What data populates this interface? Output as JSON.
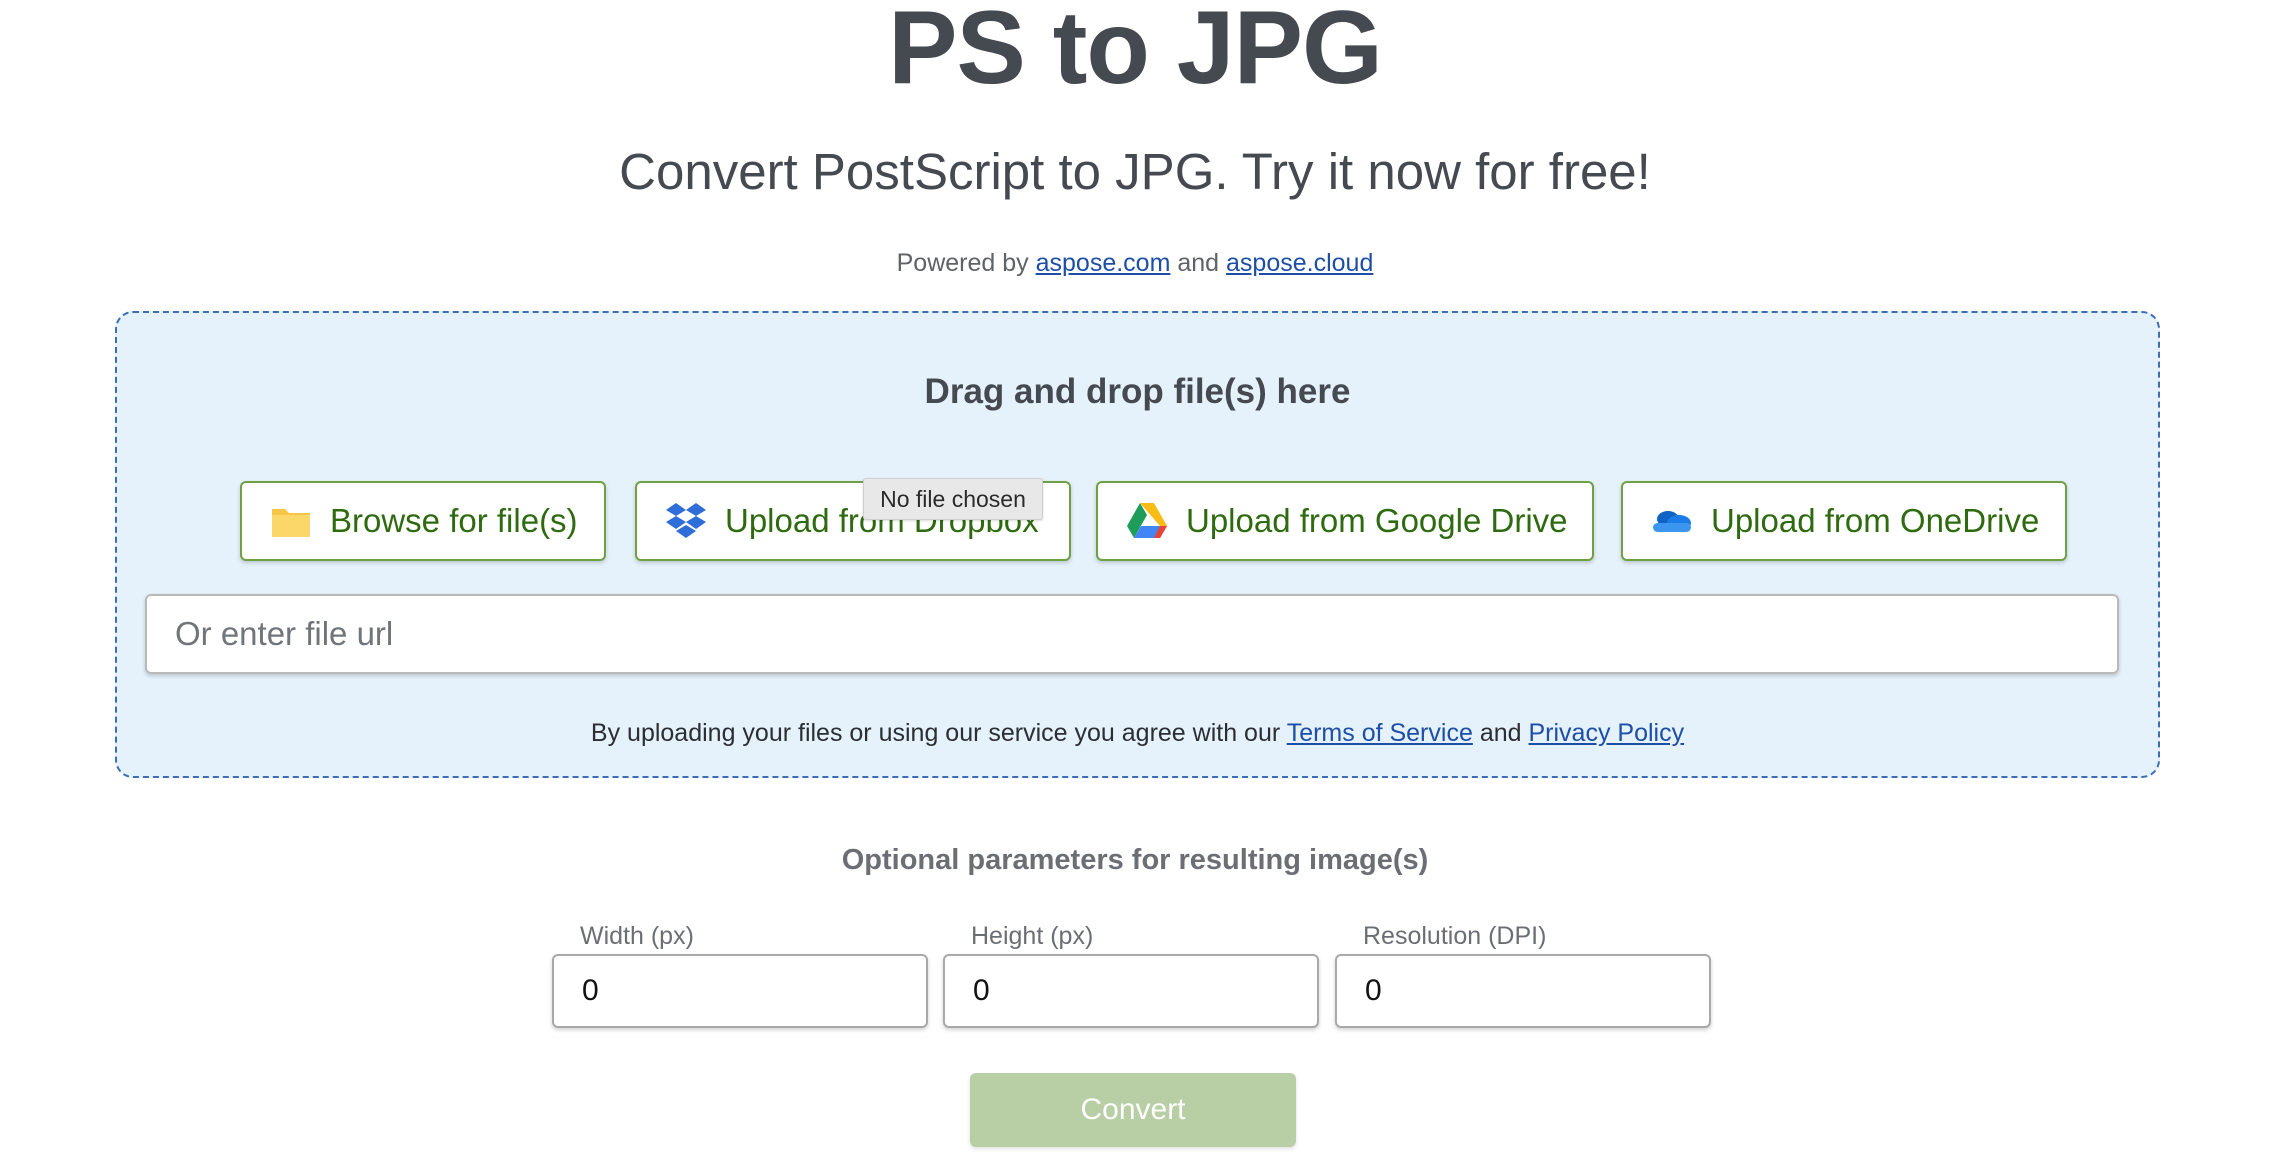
{
  "header": {
    "title": "PS to JPG",
    "subtitle": "Convert PostScript to JPG. Try it now for free!",
    "powered_prefix": "Powered by",
    "powered_link1": "aspose.com",
    "powered_and": "and",
    "powered_link2": "aspose.cloud"
  },
  "upload": {
    "drag_text": "Drag and drop file(s) here",
    "browse_label": "Browse for file(s)",
    "dropbox_label": "Upload from Dropbox",
    "gdrive_label": "Upload from Google Drive",
    "onedrive_label": "Upload from OneDrive",
    "file_tooltip": "No file chosen",
    "url_placeholder": "Or enter file url",
    "terms_prefix": "By uploading your files or using our service you agree with our",
    "terms_link": "Terms of Service",
    "terms_and": "and",
    "privacy_link": "Privacy Policy"
  },
  "params": {
    "heading": "Optional parameters for resulting image(s)",
    "width_label": "Width (px)",
    "width_value": "0",
    "height_label": "Height (px)",
    "height_value": "0",
    "resolution_label": "Resolution (DPI)",
    "resolution_value": "0"
  },
  "actions": {
    "convert_label": "Convert"
  },
  "icons": {
    "browse": "folder-icon",
    "dropbox": "dropbox-icon",
    "gdrive": "google-drive-icon",
    "onedrive": "onedrive-icon"
  },
  "colors": {
    "accent_green": "#2e6b10",
    "border_green": "#6ea044",
    "dropzone_bg": "#e5f1fb",
    "dropzone_border": "#3b6eb4",
    "link": "#1d4ea8",
    "convert_disabled": "#b8cfa5"
  }
}
